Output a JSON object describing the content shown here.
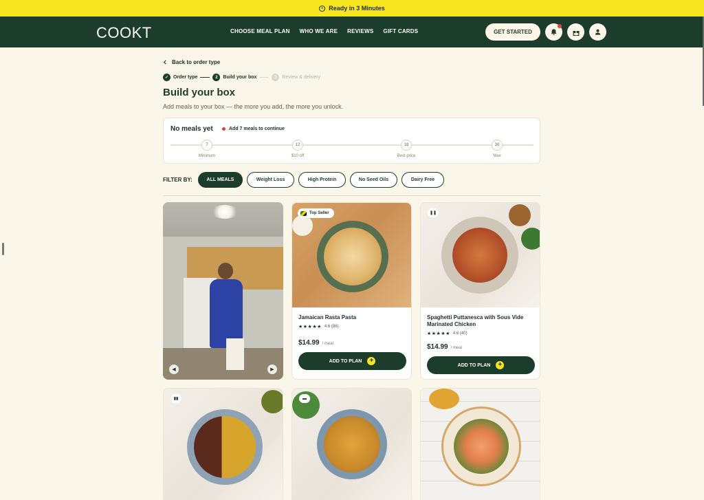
{
  "announcement": {
    "text": "Ready in 3 Minutes"
  },
  "nav": {
    "logo": "COOKT",
    "links": [
      "CHOOSE MEAL PLAN",
      "WHO WE ARE",
      "REVIEWS",
      "GIFT CARDS"
    ],
    "cta": "GET STARTED"
  },
  "page": {
    "back": "Back to order type",
    "steps": [
      {
        "num": "1",
        "label": "Order type",
        "state": "done"
      },
      {
        "num": "2",
        "label": "Build your box",
        "state": "current"
      },
      {
        "num": "3",
        "label": "Review & delivery",
        "state": "pending"
      }
    ],
    "title": "Build your box",
    "subtitle": "Add meals to your box — the more you add, the more you unlock."
  },
  "progress": {
    "title": "No meals yet",
    "hint": "Add 7 meals to continue",
    "milestones": [
      {
        "value": "7",
        "label": "Minimum"
      },
      {
        "value": "12",
        "label": "$10 off"
      },
      {
        "value": "18",
        "label": "Best price"
      },
      {
        "value": "30",
        "label": "Max"
      }
    ]
  },
  "filters": {
    "label": "FILTER BY:",
    "chips": [
      "ALL MEALS",
      "Weight Loss",
      "High Protein",
      "No Seed Oils",
      "Dairy Free"
    ],
    "active": "ALL MEALS"
  },
  "meals": [
    {
      "badge": "Top Seller",
      "name": "Jamaican Rasta Pasta",
      "stars": "★★★★★",
      "rating": "4.6 (86)",
      "price": "$14.99",
      "unit": "/ meal",
      "cta": "ADD TO PLAN"
    },
    {
      "name": "Spaghetti Puttanesca with Sous Vide Marinated Chicken",
      "stars": "★★★★★",
      "rating": "4.6 (40)",
      "price": "$14.99",
      "unit": "/ meal",
      "cta": "ADD TO PLAN"
    }
  ],
  "colors": {
    "brand": "#1c3c2c",
    "accent": "#f6e51f",
    "background": "#fbf6ea"
  }
}
